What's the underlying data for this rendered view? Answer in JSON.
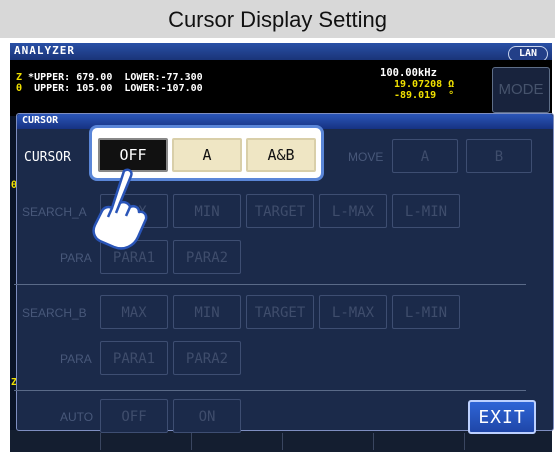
{
  "header": {
    "title": "Cursor Display Setting"
  },
  "app": {
    "title": "ANALYZER",
    "lan_label": "LAN",
    "mode_label": "MODE",
    "z_row": {
      "symbol": "Z",
      "text": " *UPPER: 679.00  LOWER:-77.300"
    },
    "theta_row": {
      "symbol": "θ",
      "text": "  UPPER: 105.00  LOWER:-107.00"
    },
    "frequency": "100.00kHz",
    "z_value": "19.07208 Ω",
    "theta_value": "-89.019  °",
    "left_marks": [
      "θ",
      "Z"
    ]
  },
  "dialog": {
    "title": "CURSOR",
    "cursor_label": "CURSOR",
    "cursor_options": [
      "OFF",
      "A",
      "A&B"
    ],
    "selected": "OFF",
    "move_label": "MOVE",
    "move_buttons": [
      "A",
      "B"
    ],
    "search_a_label": "SEARCH_A",
    "search_b_label": "SEARCH_B",
    "search_buttons": [
      "MAX",
      "MIN",
      "TARGET",
      "L-MAX",
      "L-MIN"
    ],
    "para_label": "PARA",
    "para_buttons": [
      "PARA1",
      "PARA2"
    ],
    "auto_label": "AUTO",
    "auto_buttons": [
      "OFF",
      "ON"
    ],
    "exit_label": "EXIT"
  },
  "colors": {
    "screen_bg": "#0a1428",
    "dialog_bg": "#1b2a4a",
    "accent_blue": "#2f65d6",
    "highlight_frame": "#5a86d8",
    "selected_button": "#111111",
    "option_button": "#efe6c4",
    "value_yellow": "#f0e000"
  }
}
